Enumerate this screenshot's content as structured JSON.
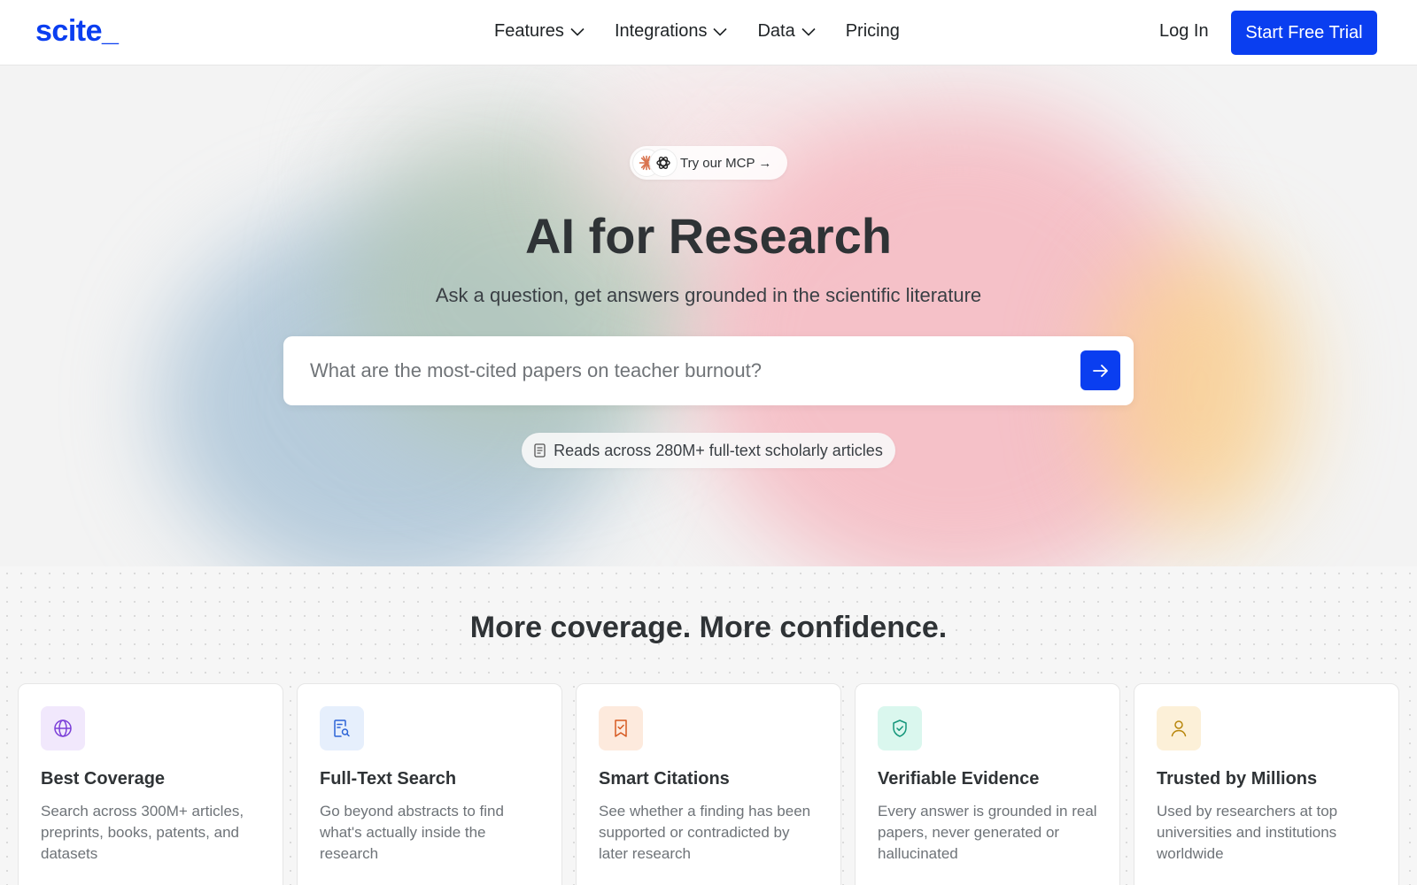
{
  "header": {
    "logo": "scite_",
    "nav": [
      {
        "label": "Features",
        "dropdown": true
      },
      {
        "label": "Integrations",
        "dropdown": true
      },
      {
        "label": "Data",
        "dropdown": true
      },
      {
        "label": "Pricing",
        "dropdown": false
      }
    ],
    "login_label": "Log In",
    "trial_label": "Start Free Trial"
  },
  "hero": {
    "mcp_label": "Try our MCP →",
    "title": "AI for Research",
    "subtitle": "Ask a question, get answers grounded in the scientific literature",
    "search_placeholder": "What are the most-cited papers on teacher burnout?",
    "reads_label": "Reads across 280M+ full-text scholarly articles"
  },
  "features": {
    "title": "More coverage. More confidence.",
    "cards": [
      {
        "title": "Best Coverage",
        "description": "Search across 300M+ articles, preprints, books, patents, and datasets",
        "icon": "globe-icon",
        "icon_bg": "#f1e8fc",
        "icon_color": "#7b3fd8"
      },
      {
        "title": "Full-Text Search",
        "description": "Go beyond abstracts to find what's actually inside the research",
        "icon": "document-search-icon",
        "icon_bg": "#e6effc",
        "icon_color": "#2c64d6"
      },
      {
        "title": "Smart Citations",
        "description": "See whether a finding has been supported or contradicted by later research",
        "icon": "bookmark-check-icon",
        "icon_bg": "#fdeadd",
        "icon_color": "#d65a21"
      },
      {
        "title": "Verifiable Evidence",
        "description": "Every answer is grounded in real papers, never generated or hallucinated",
        "icon": "shield-check-icon",
        "icon_bg": "#daf7ee",
        "icon_color": "#14967a"
      },
      {
        "title": "Trusted by Millions",
        "description": "Used by researchers at top universities and institutions worldwide",
        "icon": "user-icon",
        "icon_bg": "#fcf0d8",
        "icon_color": "#b8860b"
      }
    ]
  },
  "colors": {
    "brand": "#0a3ef0",
    "text": "#2f3336"
  }
}
